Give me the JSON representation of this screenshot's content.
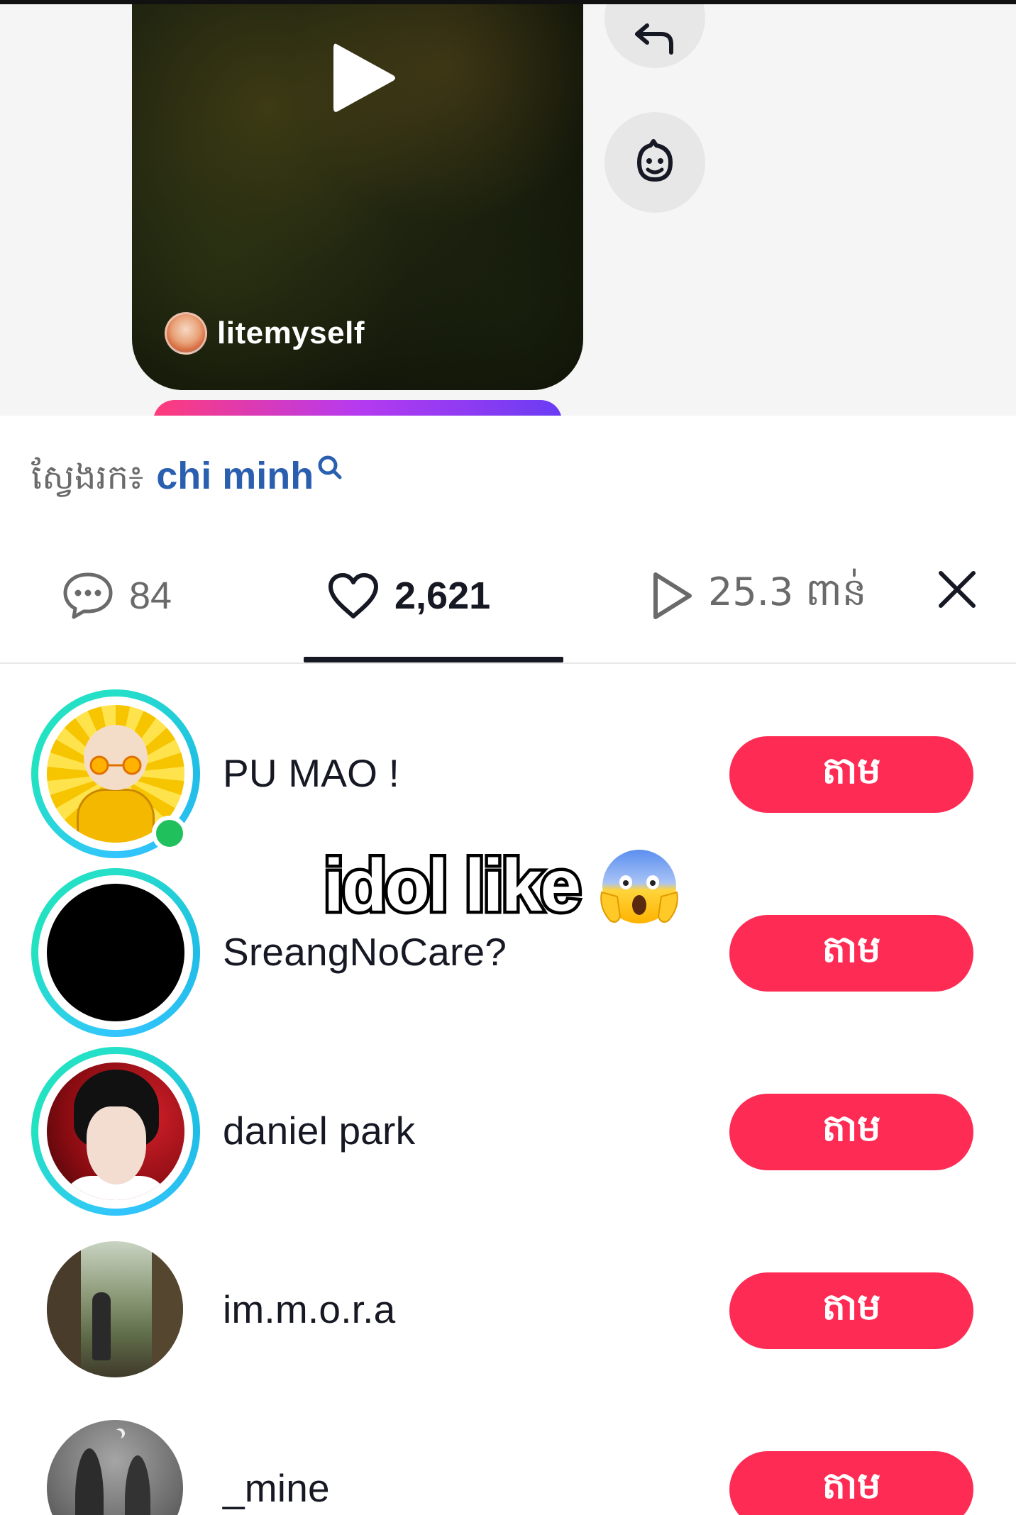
{
  "video": {
    "author_name": "litemyself"
  },
  "search_suggestion": {
    "label": "ស្វែងរក៖",
    "term": "chi minh"
  },
  "stats": {
    "comments": "84",
    "likes": "2,621",
    "plays": "25.3 ពាន់",
    "active_tab": "likes"
  },
  "overlay": {
    "caption": "idol like",
    "emoji": "face-screaming-in-fear"
  },
  "users": [
    {
      "name": "PU MAO !",
      "follow_label": "តាម",
      "online": true,
      "story_ring": true
    },
    {
      "name": "SreangNoCare?",
      "follow_label": "តាម",
      "online": false,
      "story_ring": true
    },
    {
      "name": "daniel park",
      "follow_label": "តាម",
      "online": false,
      "story_ring": true
    },
    {
      "name": "im.m.o.r.a",
      "follow_label": "តាម",
      "online": false,
      "story_ring": false
    },
    {
      "name": "_mine",
      "follow_label": "តាម",
      "online": false,
      "story_ring": false
    }
  ],
  "colors": {
    "follow_button": "#fe2c55",
    "search_term": "#2a5fb0",
    "online": "#20c05c",
    "story_ring": "#25e0c8"
  }
}
